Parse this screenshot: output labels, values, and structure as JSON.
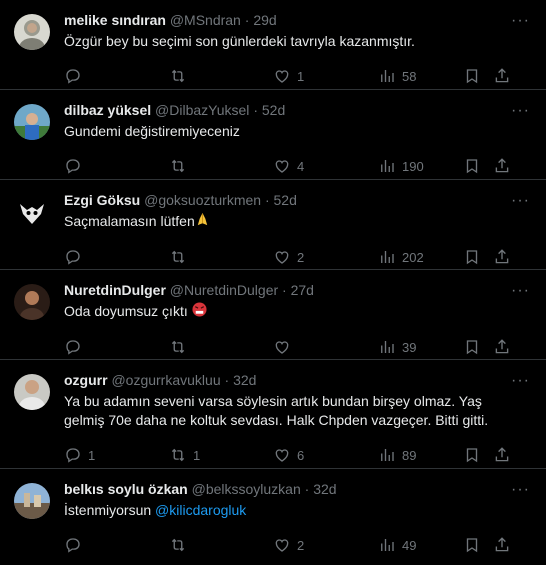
{
  "tweets": [
    {
      "name": "melike sındıran",
      "handle": "@MSndran",
      "time": "29d",
      "text": "Özgür bey bu seçimi son günlerdeki tavrıyla kazanmıştır.",
      "replies": "",
      "retweets": "",
      "likes": "1",
      "views": "58"
    },
    {
      "name": "dilbaz yüksel",
      "handle": "@DilbazYuksel",
      "time": "52d",
      "text": "Gundemi değistiremiyeceniz",
      "replies": "",
      "retweets": "",
      "likes": "4",
      "views": "190"
    },
    {
      "name": "Ezgi Göksu",
      "handle": "@goksuozturkmen",
      "time": "52d",
      "text": "Saçmalamasın lütfen",
      "emoji": "folded-hands",
      "replies": "",
      "retweets": "",
      "likes": "2",
      "views": "202"
    },
    {
      "name": "NuretdinDulger",
      "handle": "@NuretdinDulger",
      "time": "27d",
      "text": "Oda doyumsuz çıktı",
      "emoji": "angry-face",
      "replies": "",
      "retweets": "",
      "likes": "",
      "views": "39"
    },
    {
      "name": "ozgurr",
      "handle": "@ozgurrkavukluu",
      "time": "32d",
      "text": "Ya bu adamın seveni varsa söylesin artık bundan birşey olmaz. Yaş gelmiş 70e daha ne koltuk sevdası. Halk Chpden vazgeçer. Bitti gitti.",
      "replies": "1",
      "retweets": "1",
      "likes": "6",
      "views": "89"
    },
    {
      "name": "belkıs soylu özkan",
      "handle": "@belkssoyluzkan",
      "time": "32d",
      "text": "İstenmiyorsun ",
      "mention": "@kilicdarogluk",
      "replies": "",
      "retweets": "",
      "likes": "2",
      "views": "49"
    }
  ],
  "separator": "·",
  "icons": {
    "reply": "reply-icon",
    "retweet": "retweet-icon",
    "like": "heart-icon",
    "views": "views-icon",
    "bookmark": "bookmark-icon",
    "share": "share-icon",
    "more": "more-icon"
  },
  "colors": {
    "background": "#000000",
    "text": "#e7e9ea",
    "muted": "#71767b",
    "mention": "#1d9bf0",
    "border": "#2f3336"
  }
}
